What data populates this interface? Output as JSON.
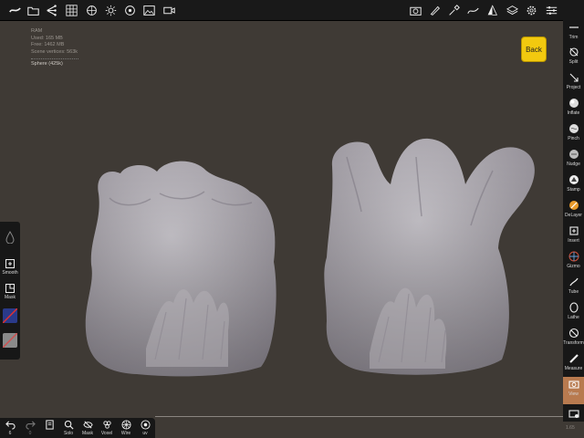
{
  "stats": {
    "ram": "RAM",
    "used": "Used: 165 MB",
    "free": "Free: 1462 MB",
    "vertices": "Scene vertices: 563k",
    "object": "Sphere (425k)"
  },
  "back_label": "Back",
  "right_tools": [
    {
      "label": "Trim",
      "icon": "trim-icon"
    },
    {
      "label": "Split",
      "icon": "split-icon"
    },
    {
      "label": "Project",
      "icon": "project-icon"
    },
    {
      "label": "Inflate",
      "icon": "inflate-icon"
    },
    {
      "label": "Pinch",
      "icon": "pinch-icon"
    },
    {
      "label": "Nudge",
      "icon": "nudge-icon"
    },
    {
      "label": "Stamp",
      "icon": "stamp-icon"
    },
    {
      "label": "DeLayer",
      "icon": "delayer-icon"
    },
    {
      "label": "Insert",
      "icon": "insert-icon"
    },
    {
      "label": "Gizmo",
      "icon": "gizmo-icon"
    },
    {
      "label": "Tube",
      "icon": "tube-icon"
    },
    {
      "label": "Lathe",
      "icon": "lathe-icon"
    },
    {
      "label": "Transform",
      "icon": "transform-icon"
    },
    {
      "label": "Measure",
      "icon": "measure-icon"
    },
    {
      "label": "View",
      "icon": "view-icon"
    }
  ],
  "left_tools": {
    "smooth": "Smooth",
    "mask": "Mask"
  },
  "bottom_tools": {
    "undo_count": "6",
    "redo_count": "0",
    "solo": "Solo",
    "mask": "Mask",
    "voxel": "Voxel",
    "wire": "Wire",
    "uv": "uv"
  },
  "version": "1.65",
  "colors": {
    "background": "#3f3a35",
    "accent": "#f2c90f",
    "active_tool": "#b87a4f"
  }
}
